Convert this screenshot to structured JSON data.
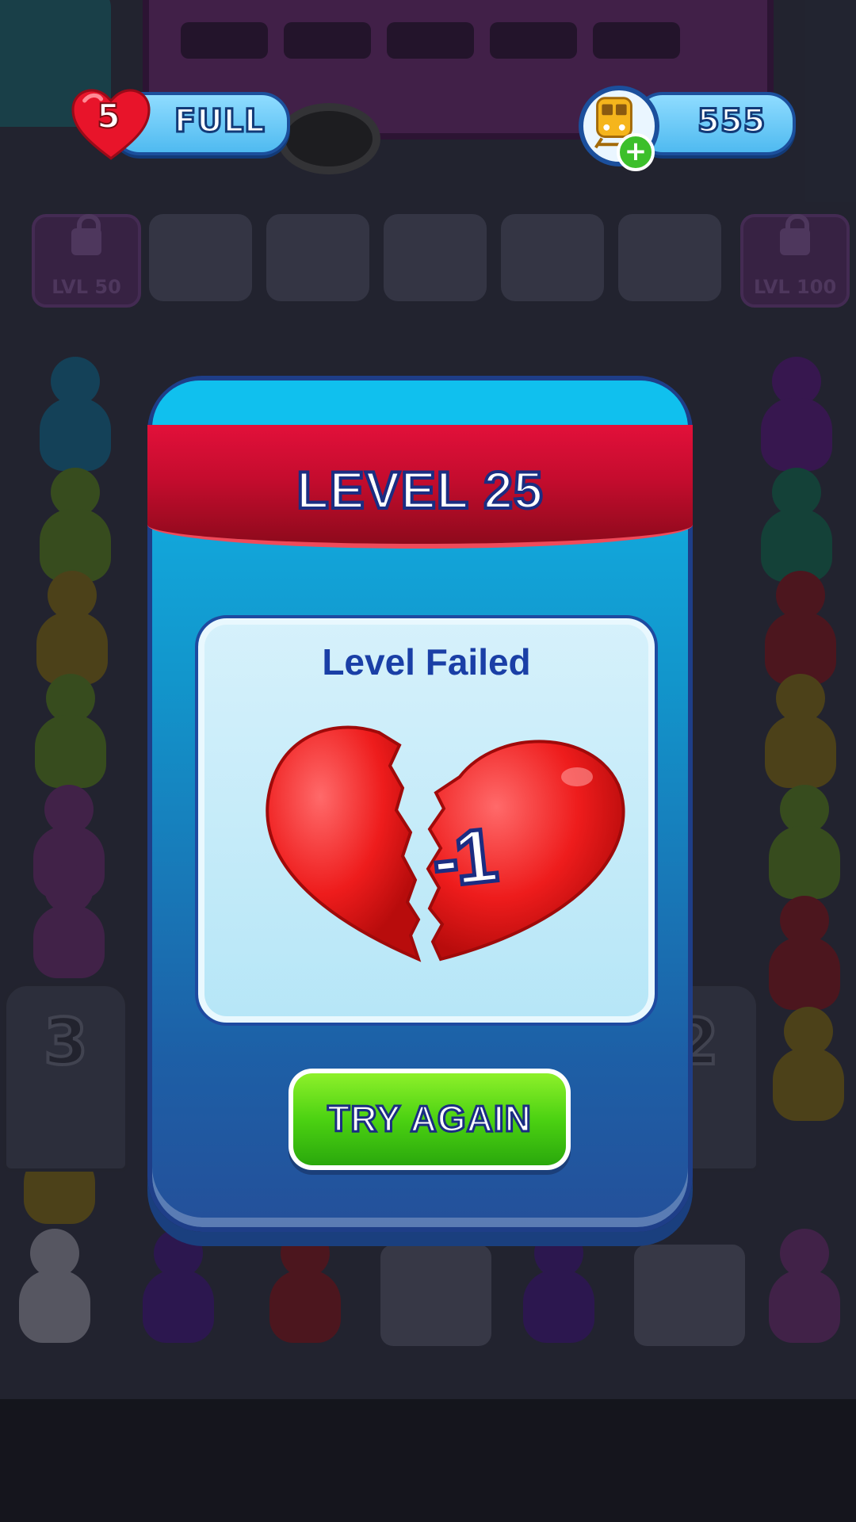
{
  "hud": {
    "lives_count": "5",
    "lives_status": "FULL",
    "coins": "555",
    "coin_icon": "train-icon",
    "add_icon": "plus-icon"
  },
  "background": {
    "locked_slots": [
      {
        "label": "LVL 50"
      },
      {
        "label": "LVL 100"
      }
    ],
    "holders": [
      "3",
      "2"
    ]
  },
  "modal": {
    "title": "LEVEL 25",
    "panel_title": "Level Failed",
    "lives_change": "-1",
    "button_label": "TRY AGAIN",
    "colors": {
      "ribbon": "#c50c2e",
      "button": "#4cd212",
      "panel_text": "#1a3fa6"
    }
  }
}
